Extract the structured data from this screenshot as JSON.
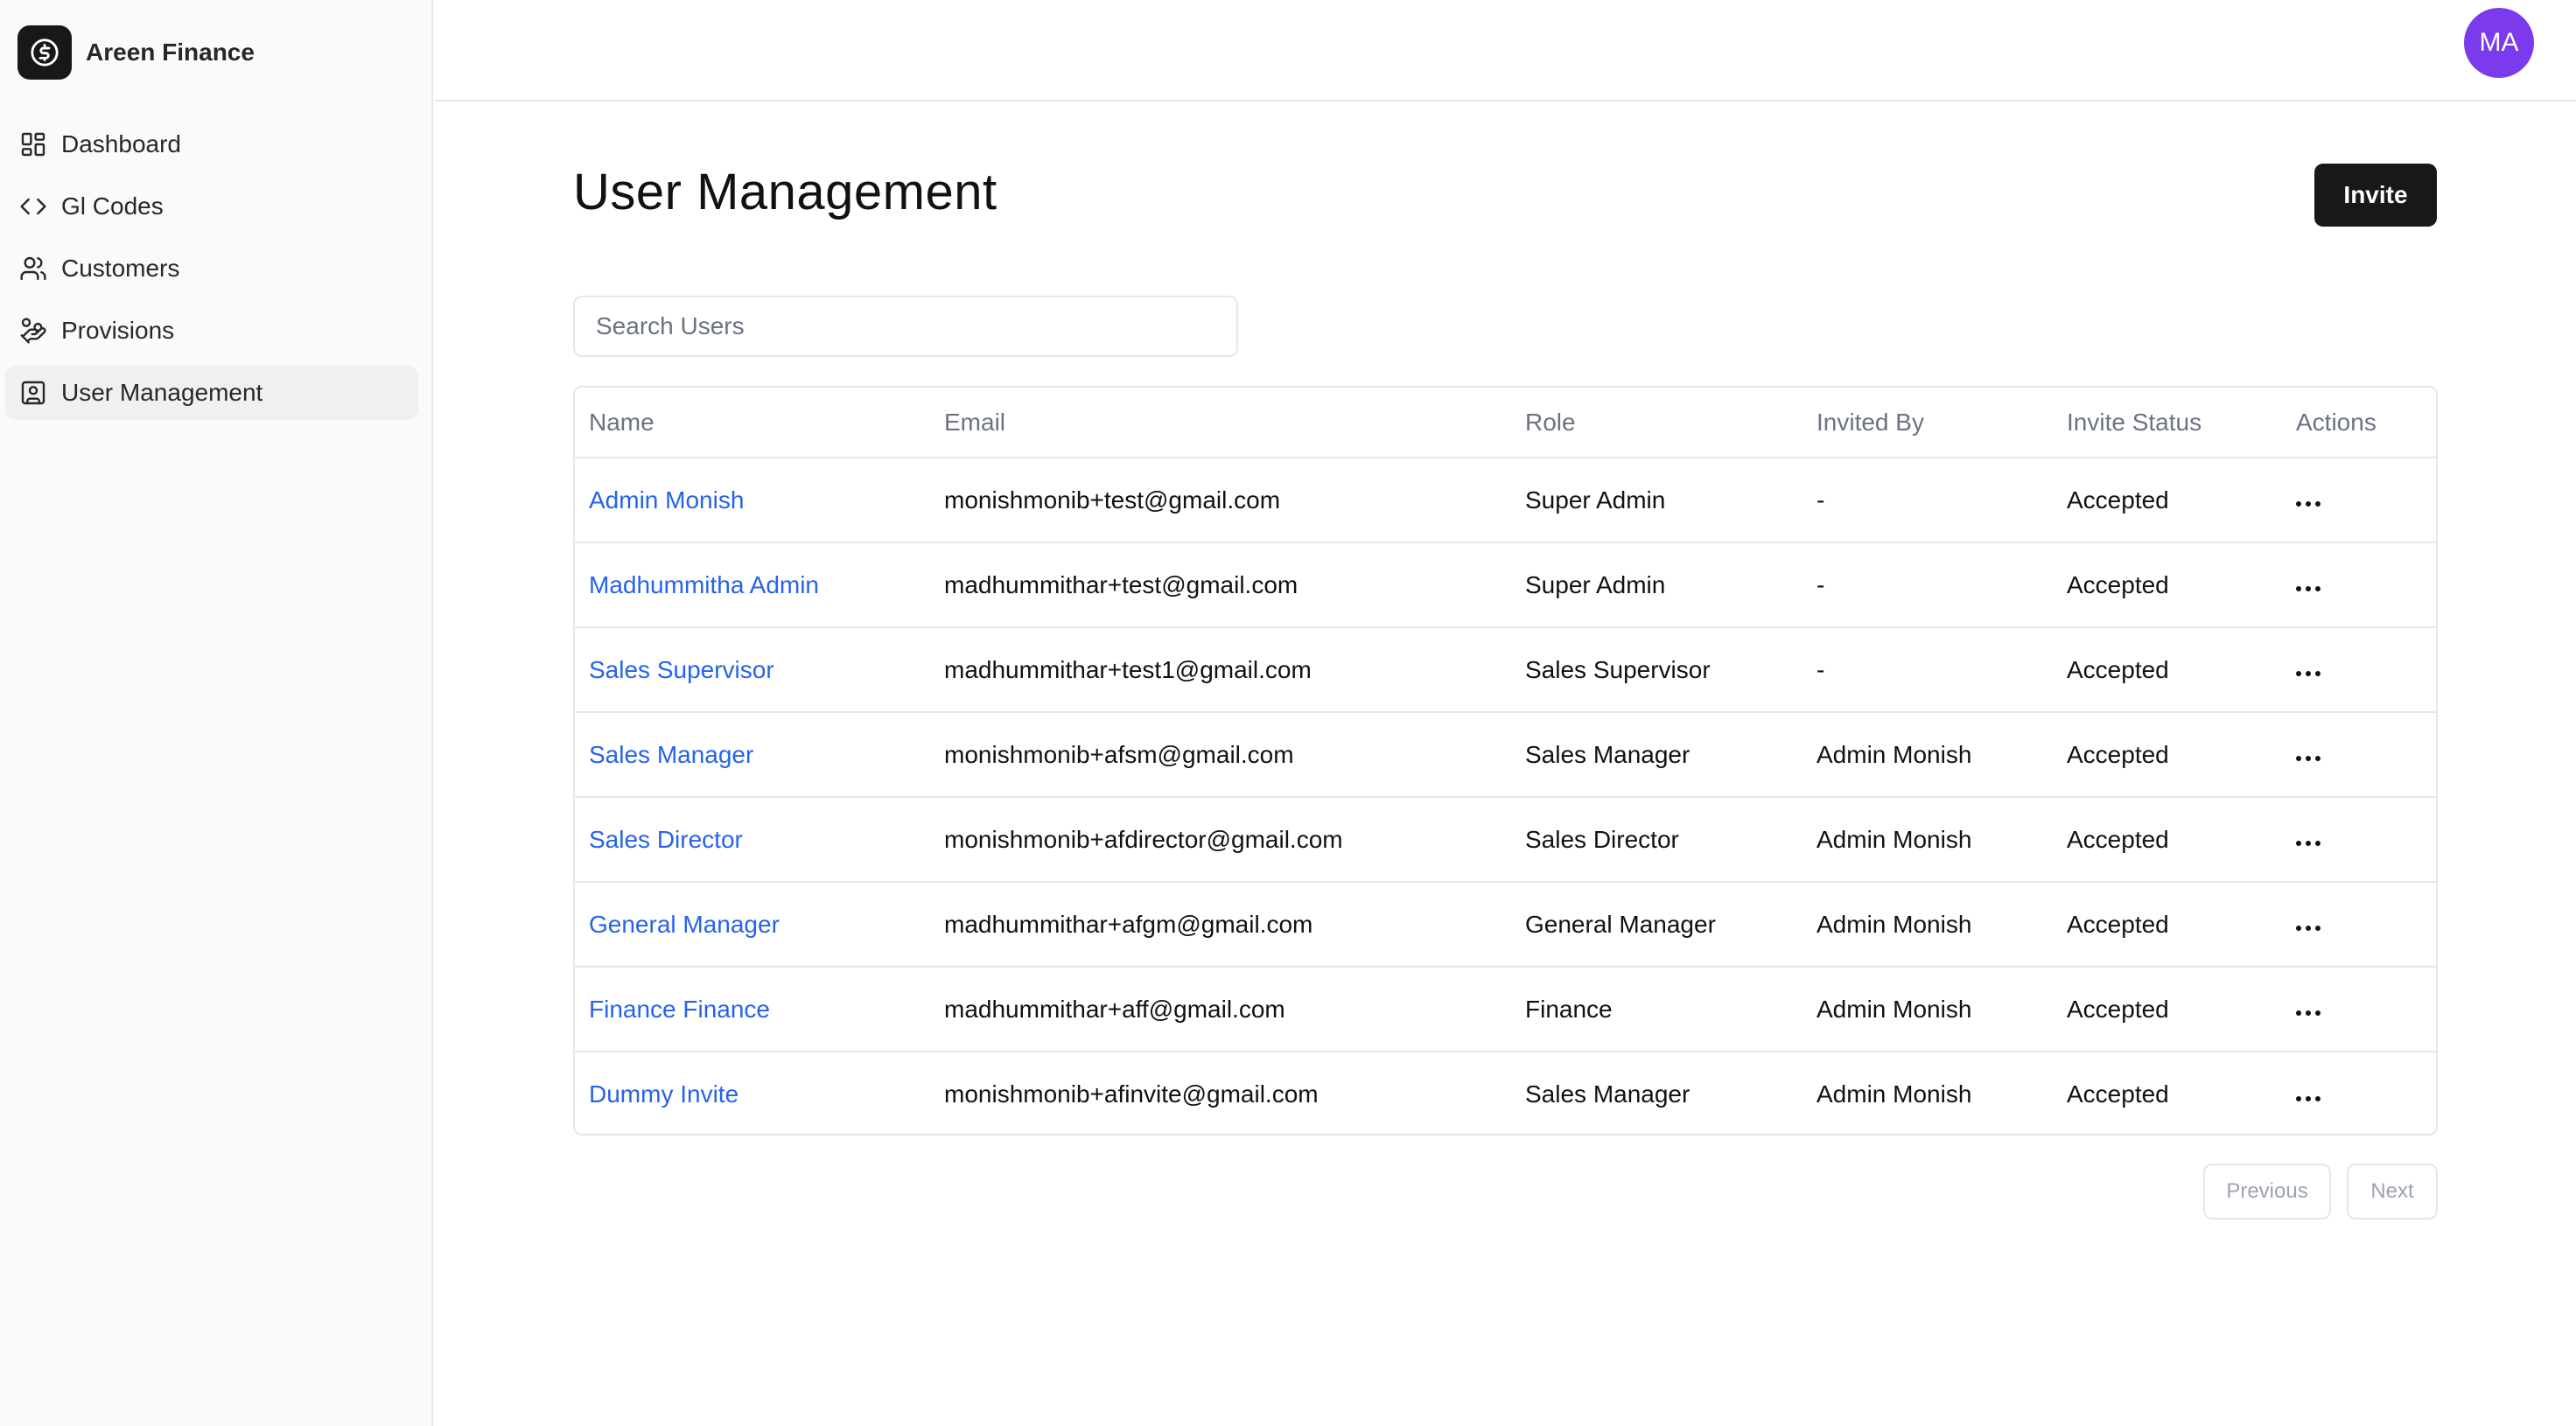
{
  "brand": {
    "name": "Areen Finance",
    "logo_icon": "dollar-circle-icon"
  },
  "sidebar": {
    "items": [
      {
        "label": "Dashboard",
        "icon": "dashboard-icon",
        "active": false
      },
      {
        "label": "Gl Codes",
        "icon": "code-icon",
        "active": false
      },
      {
        "label": "Customers",
        "icon": "users-icon",
        "active": false
      },
      {
        "label": "Provisions",
        "icon": "hand-coins-icon",
        "active": false
      },
      {
        "label": "User Management",
        "icon": "user-square-icon",
        "active": true
      }
    ]
  },
  "header": {
    "avatar_initials": "MA",
    "avatar_color": "#7c3aed"
  },
  "main": {
    "title": "User Management",
    "invite_label": "Invite",
    "search": {
      "placeholder": "Search Users",
      "value": ""
    },
    "table": {
      "columns": [
        "Name",
        "Email",
        "Role",
        "Invited By",
        "Invite Status",
        "Actions"
      ],
      "rows": [
        {
          "name": "Admin Monish",
          "email": "monishmonib+test@gmail.com",
          "role": "Super Admin",
          "invited_by": "-",
          "status": "Accepted"
        },
        {
          "name": "Madhummitha Admin",
          "email": "madhummithar+test@gmail.com",
          "role": "Super Admin",
          "invited_by": "-",
          "status": "Accepted"
        },
        {
          "name": "Sales Supervisor",
          "email": "madhummithar+test1@gmail.com",
          "role": "Sales Supervisor",
          "invited_by": "-",
          "status": "Accepted"
        },
        {
          "name": "Sales Manager",
          "email": "monishmonib+afsm@gmail.com",
          "role": "Sales Manager",
          "invited_by": "Admin Monish",
          "status": "Accepted"
        },
        {
          "name": "Sales Director",
          "email": "monishmonib+afdirector@gmail.com",
          "role": "Sales Director",
          "invited_by": "Admin Monish",
          "status": "Accepted"
        },
        {
          "name": "General Manager",
          "email": "madhummithar+afgm@gmail.com",
          "role": "General Manager",
          "invited_by": "Admin Monish",
          "status": "Accepted"
        },
        {
          "name": "Finance Finance",
          "email": "madhummithar+aff@gmail.com",
          "role": "Finance",
          "invited_by": "Admin Monish",
          "status": "Accepted"
        },
        {
          "name": "Dummy Invite",
          "email": "monishmonib+afinvite@gmail.com",
          "role": "Sales Manager",
          "invited_by": "Admin Monish",
          "status": "Accepted"
        }
      ]
    },
    "pagination": {
      "previous_label": "Previous",
      "next_label": "Next"
    }
  },
  "colors": {
    "link": "#2563eb",
    "primary_button": "#18181b",
    "sidebar_bg": "#fafafa",
    "active_item_bg": "#f0f0f1"
  }
}
